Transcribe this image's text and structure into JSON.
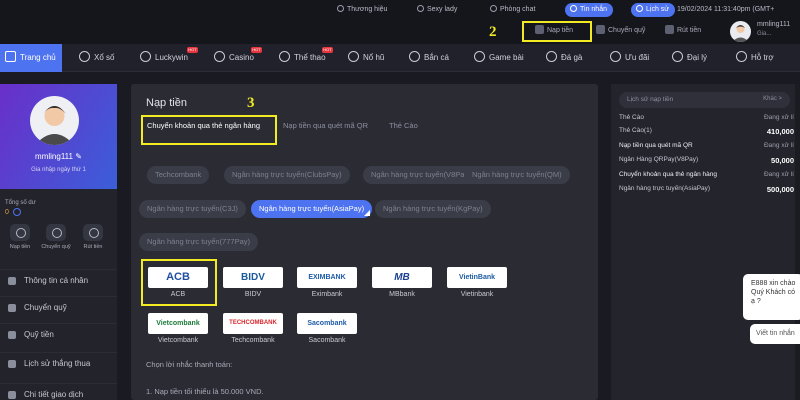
{
  "topbar": {
    "pills": [
      "Thương hiệu",
      "Sexy lady",
      "Phòng chat",
      "Tin nhắn",
      "Lịch sử"
    ],
    "datetime": "19/02/2024 11:31:40pm (GMT+",
    "quick_actions": [
      "Nạp tiền",
      "Chuyển quỹ",
      "Rút tiền"
    ],
    "username": "mmling111",
    "avatar_label": "Gia..."
  },
  "nav": {
    "items": [
      "Trang chủ",
      "Xổ số",
      "Luckywin",
      "Casino",
      "Thể thao",
      "Nổ hũ",
      "Bắn cá",
      "Game bài",
      "Đá gà",
      "Ưu đãi",
      "Đại lý",
      "Hỗ trợ"
    ],
    "hot_label": "HOT"
  },
  "sidebar": {
    "username": "mmling111",
    "login_info": "Gia nhập ngày thứ 1",
    "balance_label": "Tổng số dư",
    "balance_value": "0",
    "mini_actions": [
      "Nạp tiền",
      "Chuyển quỹ",
      "Rút tiền"
    ],
    "items": [
      "Thông tin cá nhân",
      "Chuyển quỹ",
      "Quỹ tiền",
      "Lịch sử thắng thua",
      "Chi tiết giao dịch"
    ]
  },
  "main": {
    "title": "Nạp tiền",
    "tabs": [
      "Chuyển khoản qua thẻ ngân hàng",
      "Nạp tiền qua quét mã QR",
      "Thẻ Cào"
    ],
    "channels": [
      "Techcombank",
      "Ngân hàng trực tuyến(ClubsPay)",
      "Ngân hàng trực tuyến(V8Pay)",
      "Ngân hàng trực tuyến(QM)",
      "Ngân hàng trực tuyến(C3J)",
      "Ngân hàng trực tuyến(AsiaPay)",
      "Ngân hàng trực tuyến(KgPay)",
      "Ngân hàng trực tuyến(777Pay)"
    ],
    "banks": [
      {
        "logo": "ACB",
        "name": "ACB",
        "color": "#1f4fa3"
      },
      {
        "logo": "BIDV",
        "name": "BIDV",
        "color": "#1a5a9a"
      },
      {
        "logo": "EXIMBANK",
        "name": "Eximbank",
        "color": "#1c5aa6"
      },
      {
        "logo": "MB",
        "name": "MBbank",
        "color": "#1c3f94"
      },
      {
        "logo": "VietinBank",
        "name": "Vietinbank",
        "color": "#1b5aa0"
      },
      {
        "logo": "Vietcombank",
        "name": "Vietcombank",
        "color": "#1b7a3a"
      },
      {
        "logo": "TECHCOMBANK",
        "name": "Techcombank",
        "color": "#d8262d"
      },
      {
        "logo": "Sacombank",
        "name": "Sacombank",
        "color": "#1e5aa8"
      }
    ],
    "reminder_label": "Chọn lời nhắc thanh toán:",
    "min_note": "1. Nạp tiền tối thiểu là 50.000 VND."
  },
  "annotations": {
    "step2": "2",
    "step3": "3"
  },
  "right": {
    "header": "Lịch sử nạp tiền",
    "more": "Khác >",
    "rows": [
      {
        "left": "Thẻ Cào",
        "right": "Đang xử lí",
        "bold": false,
        "value": false
      },
      {
        "left": "Thẻ Cào(1)",
        "right": "410,000",
        "bold": false,
        "value": true
      },
      {
        "left": "Nạp tiền qua quét mã QR",
        "right": "Đang xử lí",
        "bold": true,
        "value": false
      },
      {
        "left": "Ngân Hàng QRPay(V8Pay)",
        "right": "50,000",
        "bold": false,
        "value": true
      },
      {
        "left": "Chuyển khoản qua thẻ ngân hàng",
        "right": "Đang xử lí",
        "bold": true,
        "value": false
      },
      {
        "left": "Ngân hàng trực tuyến(AsiaPay)",
        "right": "500,000",
        "bold": false,
        "value": true
      }
    ]
  },
  "chat": {
    "bubble": "E888 xin chào Quý Khách có ạ ?",
    "input_placeholder": "Viết tin nhắn"
  }
}
